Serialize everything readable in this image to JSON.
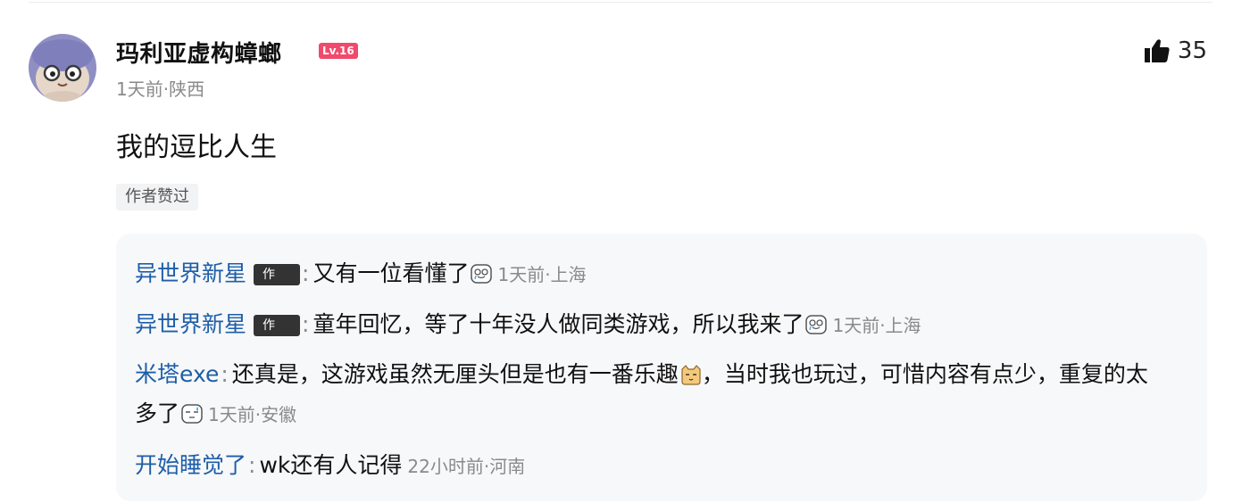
{
  "comment": {
    "author": "玛利亚虚构蟑螂",
    "level": "Lv.16",
    "meta": "1天前·陕西",
    "likes": "35",
    "content": "我的逗比人生",
    "tag": "作者赞过"
  },
  "replies": [
    {
      "name": "异世界新星",
      "author_tag": "作",
      "colon": ":",
      "text": "又有一位看懂了",
      "emoji": "crying-face-emoji",
      "time": "1天前·上海"
    },
    {
      "name": "异世界新星",
      "author_tag": "作",
      "colon": ":",
      "text": "童年回忆，等了十年没人做同类游戏，所以我来了",
      "emoji": "crying-face-emoji",
      "time": "1天前·上海"
    },
    {
      "name": "米塔exe",
      "colon": ":",
      "text_a": "还真是，这游戏虽然无厘头但是也有一番乐趣",
      "emoji_a": "cat-face-emoji",
      "text_b": "，当时我也玩过，可惜内容有点少，重复的太多了",
      "emoji_b": "sweat-face-emoji",
      "time": "1天前·安徽"
    },
    {
      "name": "开始睡觉了",
      "colon": ":",
      "text": "wk还有人记得",
      "time": "22小时前·河南"
    }
  ],
  "colors": {
    "reply_name": "#1e5ea8",
    "level_badge": "#f04a6c",
    "replies_bg": "#f7f8fa"
  }
}
